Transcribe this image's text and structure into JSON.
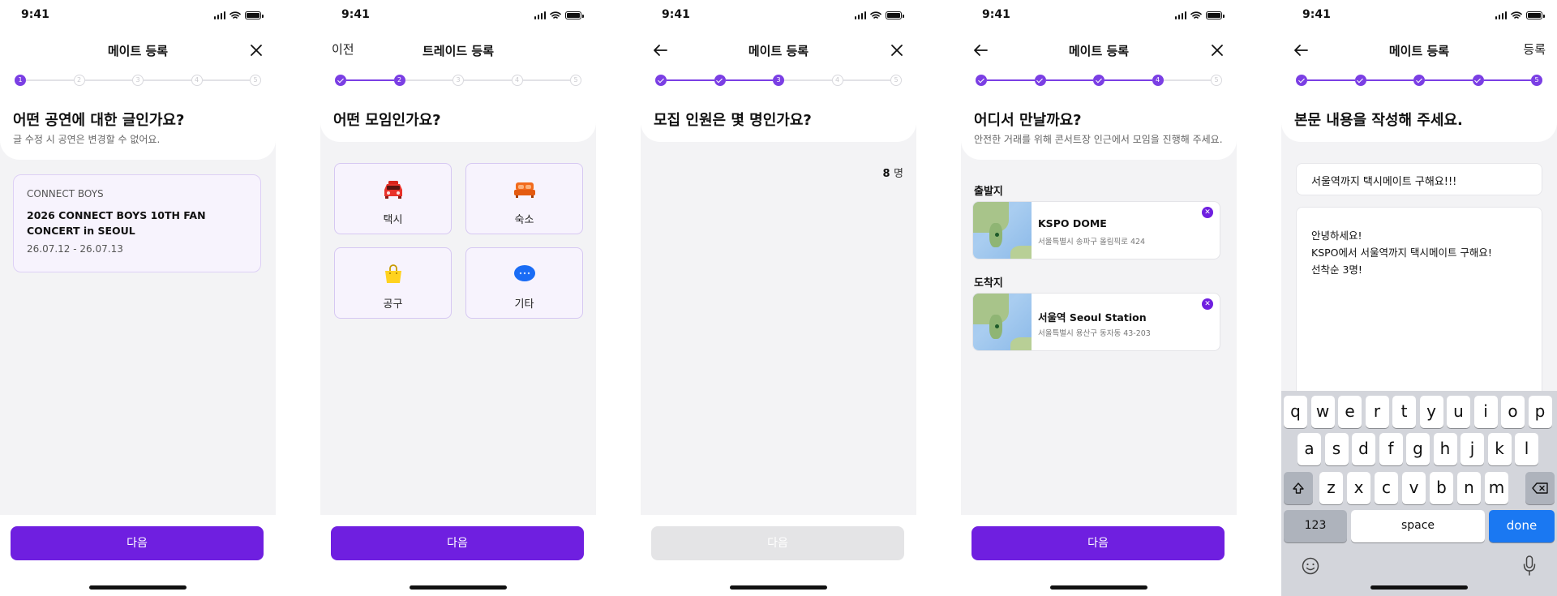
{
  "status_time": "9:41",
  "colors": {
    "accent": "#6f1fe0",
    "step_active": "#7b3fe4",
    "disabled": "#e4e4e6"
  },
  "screens": {
    "s1": {
      "title": "메이트 등록",
      "steps": [
        "1",
        "2",
        "3",
        "4",
        "5"
      ],
      "question": "어떤 공연에 대한 글인가요?",
      "sub": "글 수정 시 공연은 변경할 수 없어요.",
      "concert": {
        "artist": "CONNECT BOYS",
        "title": "2026 CONNECT BOYS 10TH FAN CONCERT in SEOUL",
        "date": "26.07.12 - 26.07.13"
      },
      "next": "다음"
    },
    "s2": {
      "prev": "이전",
      "title": "트레이드 등록",
      "steps": [
        "1",
        "2",
        "3",
        "4",
        "5"
      ],
      "question": "어떤 모임인가요?",
      "categories": [
        {
          "label": "택시",
          "icon": "taxi-icon"
        },
        {
          "label": "숙소",
          "icon": "bed-icon"
        },
        {
          "label": "공구",
          "icon": "shopping-bag-icon"
        },
        {
          "label": "기타",
          "icon": "chat-bubble-icon"
        }
      ],
      "next": "다음"
    },
    "s3": {
      "title": "메이트 등록",
      "steps": [
        "1",
        "2",
        "3",
        "4",
        "5"
      ],
      "question": "모집 인원은 몇 명인가요?",
      "count": "8",
      "unit": "명",
      "next": "다음"
    },
    "s4": {
      "title": "메이트 등록",
      "steps": [
        "1",
        "2",
        "3",
        "4",
        "5"
      ],
      "question": "어디서 만날까요?",
      "sub": "안전한 거래를 위해 콘서트장 인근에서 모임을 진행해 주세요.",
      "departure_label": "출발지",
      "departure": {
        "name": "KSPO DOME",
        "address": "서울특별시 송파구 올림픽로 424"
      },
      "arrival_label": "도착지",
      "arrival": {
        "name": "서울역 Seoul Station",
        "address": "서울특별시 용산구 동자동 43-203"
      },
      "next": "다음"
    },
    "s5": {
      "title": "메이트 등록",
      "right": "등록",
      "steps": [
        "1",
        "2",
        "3",
        "4",
        "5"
      ],
      "question": "본문 내용을 작성해 주세요.",
      "title_value": "서울역까지 택시메이트 구해요!!!",
      "body_value": "안녕하세요!\nKSPO에서 서울역까지 택시메이트 구해요!\n선착순 3명!",
      "keyboard": {
        "row1": [
          "q",
          "w",
          "e",
          "r",
          "t",
          "y",
          "u",
          "i",
          "o",
          "p"
        ],
        "row2": [
          "a",
          "s",
          "d",
          "f",
          "g",
          "h",
          "j",
          "k",
          "l"
        ],
        "row3": [
          "z",
          "x",
          "c",
          "v",
          "b",
          "n",
          "m"
        ],
        "numbers": "123",
        "space": "space",
        "done": "done"
      }
    }
  }
}
